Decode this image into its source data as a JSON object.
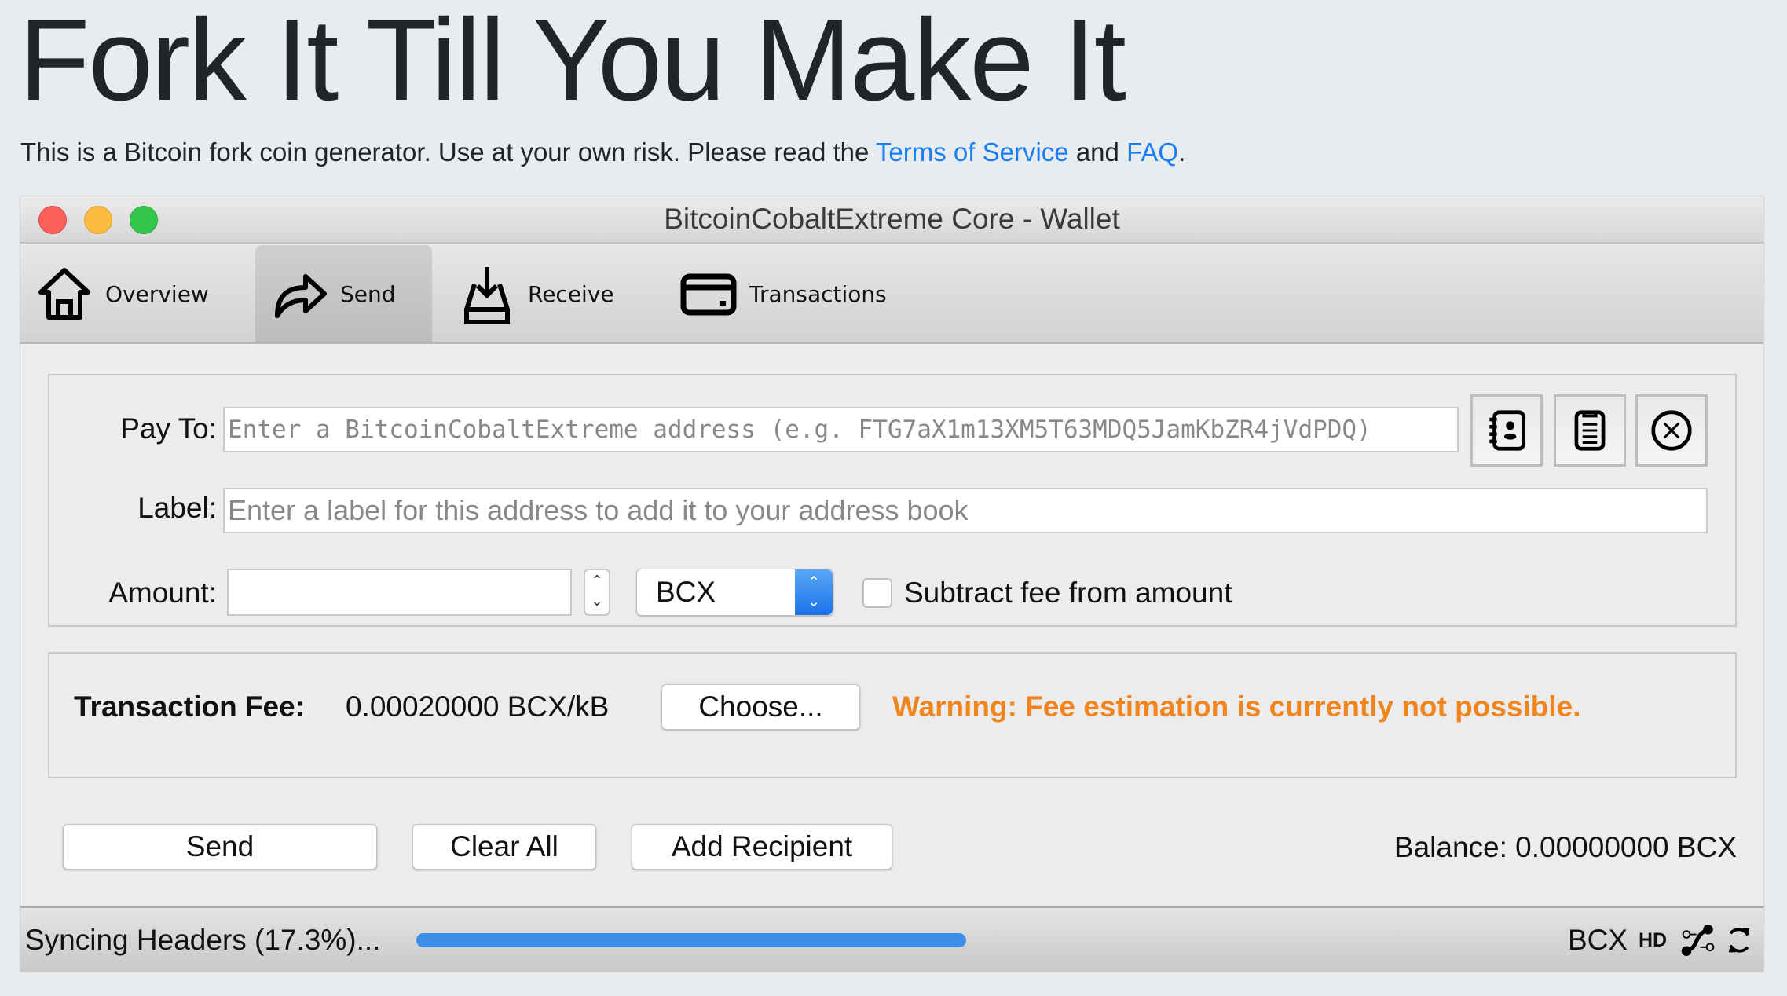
{
  "page": {
    "heading": "Fork It Till You Make It",
    "intro_prefix": "This is a Bitcoin fork coin generator. Use at your own risk. Please read the ",
    "tos_link": "Terms of Service",
    "intro_and": " and ",
    "faq_link": "FAQ",
    "intro_suffix": ".",
    "link_color": "#1a7ff0"
  },
  "window": {
    "title": "BitcoinCobaltExtreme Core - Wallet",
    "traffic_lights": [
      "#fc605b",
      "#fdbc40",
      "#34c84a"
    ]
  },
  "toolbar": {
    "tabs": [
      {
        "label": "Overview",
        "icon": "home-icon"
      },
      {
        "label": "Send",
        "icon": "send-arrow-icon",
        "active": true
      },
      {
        "label": "Receive",
        "icon": "receive-inbox-icon"
      },
      {
        "label": "Transactions",
        "icon": "card-icon"
      }
    ]
  },
  "recipient": {
    "pay_to_label": "Pay To:",
    "pay_to_placeholder": "Enter a BitcoinCobaltExtreme address (e.g. FTG7aX1m13XM5T63MDQ5JamKbZR4jVdPDQ)",
    "label_label": "Label:",
    "label_placeholder": "Enter a label for this address to add it to your address book",
    "amount_label": "Amount:",
    "amount_value": "",
    "unit": "BCX",
    "subtract_fee_label": "Subtract fee from amount",
    "subtract_fee_checked": false
  },
  "fee": {
    "label": "Transaction Fee:",
    "value": "0.00020000 BCX/kB",
    "choose_button": "Choose...",
    "warning": "Warning: Fee estimation is currently not possible.",
    "warning_color": "#f0851d"
  },
  "actions": {
    "send": "Send",
    "clear_all": "Clear All",
    "add_recipient": "Add Recipient",
    "balance": "Balance: 0.00000000 BCX"
  },
  "status": {
    "text": "Syncing Headers (17.3%)...",
    "progress_percent": 17.3,
    "unit": "BCX",
    "hd": "HD",
    "progress_color": "#3d8ee8"
  }
}
